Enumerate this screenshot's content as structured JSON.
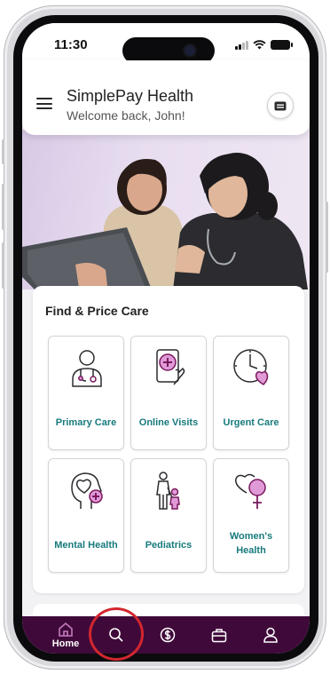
{
  "status_bar": {
    "time": "11:30"
  },
  "header": {
    "title": "SimplePay Health",
    "subtitle": "Welcome back, John!",
    "menu_icon": "hamburger-menu-icon",
    "card_icon": "id-card-icon"
  },
  "hero": {
    "image": "two-women-looking-at-tablet"
  },
  "find_care": {
    "title": "Find & Price Care",
    "tiles": [
      {
        "label": "Primary Care",
        "icon": "doctor-icon"
      },
      {
        "label": "Online Visits",
        "icon": "phone-medical-icon"
      },
      {
        "label": "Urgent Care",
        "icon": "clock-heart-icon"
      },
      {
        "label": "Mental Health",
        "icon": "head-heart-icon"
      },
      {
        "label": "Pediatrics",
        "icon": "parent-child-icon"
      },
      {
        "label": "Women's Health",
        "icon": "female-heart-icon"
      }
    ]
  },
  "tabs": [
    {
      "label": "Home",
      "icon": "home-icon",
      "active": true
    },
    {
      "label": "",
      "icon": "search-icon",
      "active": false
    },
    {
      "label": "",
      "icon": "dollar-icon",
      "active": false
    },
    {
      "label": "",
      "icon": "briefcase-icon",
      "active": false
    },
    {
      "label": "",
      "icon": "profile-icon",
      "active": false
    }
  ],
  "colors": {
    "accent_teal": "#177a7c",
    "icon_purple": "#7a1a5e",
    "icon_pink": "#e19ad8",
    "tabbar": "#3f0a3a",
    "highlight_circle": "#d3262f"
  }
}
